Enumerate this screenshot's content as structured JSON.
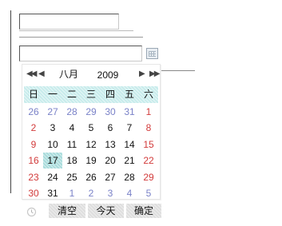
{
  "form": {
    "field1_value": "",
    "field2_value": ""
  },
  "calendar": {
    "nav": {
      "prev_year": "◀◀",
      "prev_month": "◀",
      "next_month": "▶",
      "next_year": "▶▶"
    },
    "month": "八月",
    "year": "2009",
    "weekdays": [
      "日",
      "一",
      "二",
      "三",
      "四",
      "五",
      "六"
    ],
    "weeks": [
      [
        "26",
        "27",
        "28",
        "29",
        "30",
        "31",
        "1"
      ],
      [
        "2",
        "3",
        "4",
        "5",
        "6",
        "7",
        "8"
      ],
      [
        "9",
        "10",
        "11",
        "12",
        "13",
        "14",
        "15"
      ],
      [
        "16",
        "17",
        "18",
        "19",
        "20",
        "21",
        "22"
      ],
      [
        "23",
        "24",
        "25",
        "26",
        "27",
        "28",
        "29"
      ],
      [
        "30",
        "31",
        "1",
        "2",
        "3",
        "4",
        "5"
      ]
    ],
    "other_month_cells": [
      [
        0,
        0
      ],
      [
        0,
        1
      ],
      [
        0,
        2
      ],
      [
        0,
        3
      ],
      [
        0,
        4
      ],
      [
        0,
        5
      ],
      [
        5,
        2
      ],
      [
        5,
        3
      ],
      [
        5,
        4
      ],
      [
        5,
        5
      ],
      [
        5,
        6
      ]
    ],
    "selected_day": "17",
    "footer": {
      "clear_label": "清空",
      "today_label": "今天",
      "ok_label": "确定"
    }
  },
  "colors": {
    "weekday_bg": "#c8ecec",
    "selected_bg": "#a9dcdc",
    "weekend_text": "#d23b3b",
    "other_month_text": "#7a82c8",
    "button_bg": "#dedede"
  },
  "icons": {
    "calendar_button": "calendar-icon",
    "footer_left": "clock-icon"
  }
}
